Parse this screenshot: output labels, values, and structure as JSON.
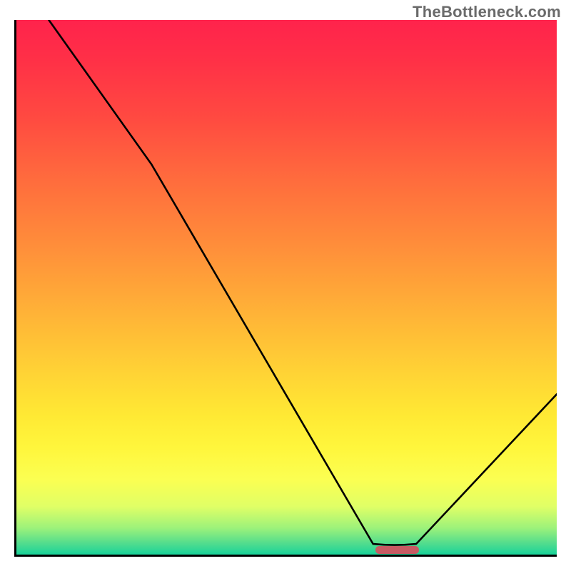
{
  "watermark": "TheBottleneck.com",
  "chart_data": {
    "type": "line",
    "title": "",
    "xlabel": "",
    "ylabel": "",
    "xlim": [
      0,
      100
    ],
    "ylim": [
      0,
      100
    ],
    "grid": false,
    "curve_segments": [
      {
        "kind": "line",
        "points": [
          [
            6,
            100
          ],
          [
            25,
            73
          ]
        ]
      },
      {
        "kind": "line",
        "points": [
          [
            25,
            73
          ],
          [
            66,
            2
          ]
        ]
      },
      {
        "kind": "flat",
        "points": [
          [
            66,
            2
          ],
          [
            74,
            2
          ]
        ]
      },
      {
        "kind": "line",
        "points": [
          [
            74,
            2
          ],
          [
            100,
            30
          ]
        ]
      }
    ],
    "optimal_region": {
      "x_start": 66.5,
      "x_end": 74.5
    },
    "background_gradient": {
      "stops": [
        {
          "pos": 0,
          "color": "#ff234c"
        },
        {
          "pos": 50,
          "color": "#ffb337"
        },
        {
          "pos": 80,
          "color": "#fff63c"
        },
        {
          "pos": 100,
          "color": "#19d39a"
        }
      ]
    }
  }
}
